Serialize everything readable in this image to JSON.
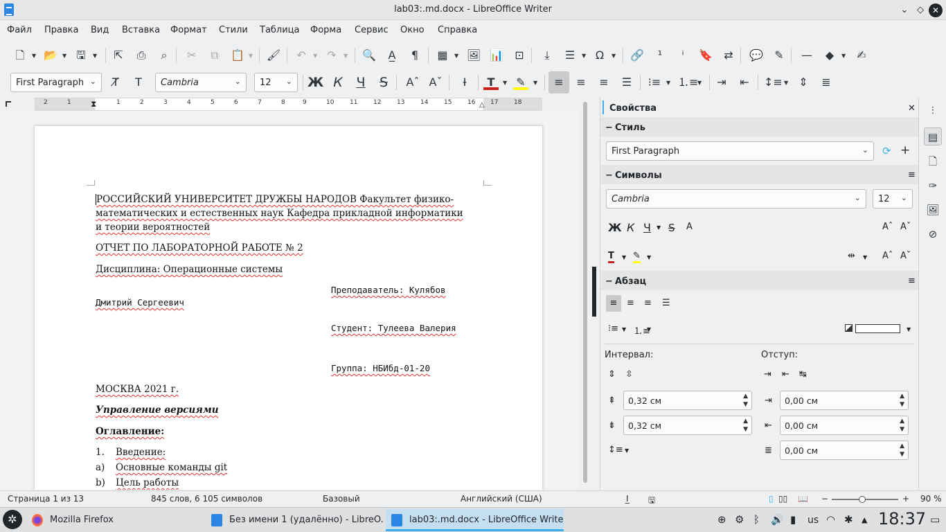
{
  "window": {
    "title": "lab03:.md.docx - LibreOffice Writer"
  },
  "menu": [
    "Файл",
    "Правка",
    "Вид",
    "Вставка",
    "Формат",
    "Стили",
    "Таблица",
    "Форма",
    "Сервис",
    "Окно",
    "Справка"
  ],
  "formatting": {
    "paragraph_style": "First Paragraph",
    "font_name": "Cambria",
    "font_size": "12",
    "bold": "Ж",
    "italic": "К",
    "underline": "Ч",
    "strike": "S"
  },
  "ruler": {
    "numbers": [
      "2",
      "1",
      "1",
      "2",
      "3",
      "4",
      "5",
      "6",
      "7",
      "8",
      "9",
      "10",
      "11",
      "12",
      "13",
      "14",
      "15",
      "16",
      "17",
      "18"
    ]
  },
  "document": {
    "line1": "РОССИЙСКИЙ УНИВЕРСИТЕТ ДРУЖБЫ НАРОДОВ Факультет физико-",
    "line2": "математических и естественных наук Кафедра прикладной информатики",
    "line3": "и теории вероятностей",
    "report": "ОТЧЕТ ПО ЛАБОРАТОРНОЙ РАБОТЕ № 2",
    "discipline": "Дисциплина: Операционные системы",
    "teacher1": "Преподаватель: Кулябов",
    "teacher2": "Дмитрий Сергеевич",
    "student": "Студент: Тулеева Валерия",
    "group": "Группа: НБИбд-01-20",
    "city": "МОСКВА 2021 г.",
    "heading": "Управление версиями",
    "toc": "Оглавление:",
    "list": [
      {
        "marker": "1.",
        "text": "Введение:"
      },
      {
        "marker": "a)",
        "text": "Основные команды git"
      },
      {
        "marker": "b)",
        "text": "Цель работы"
      }
    ]
  },
  "sidebar": {
    "title": "Свойства",
    "style_section": "Стиль",
    "style_value": "First Paragraph",
    "chars_section": "Символы",
    "font_name": "Cambria",
    "font_size": "12",
    "para_section": "Абзац",
    "spacing_label": "Интервал:",
    "indent_label": "Отступ:",
    "spacing_above": "0,32 см",
    "spacing_below": "0,32 см",
    "indent_before": "0,00 см",
    "indent_after": "0,00 см",
    "indent_first": "0,00 см"
  },
  "status": {
    "page": "Страница 1 из 13",
    "words": "845 слов, 6 105 символов",
    "style": "Базовый",
    "language": "Английский (США)",
    "zoom": "90 %"
  },
  "taskbar": {
    "tasks": [
      "Mozilla Firefox",
      "Без имени 1 (удалённо) - LibreO...",
      "lab03:.md.docx - LibreOffice Writer"
    ],
    "kbd": "us",
    "clock": "18:37"
  },
  "colors": {
    "accent": "#3daee9",
    "font_color": "#c9211e",
    "highlight": "#ffff00"
  }
}
